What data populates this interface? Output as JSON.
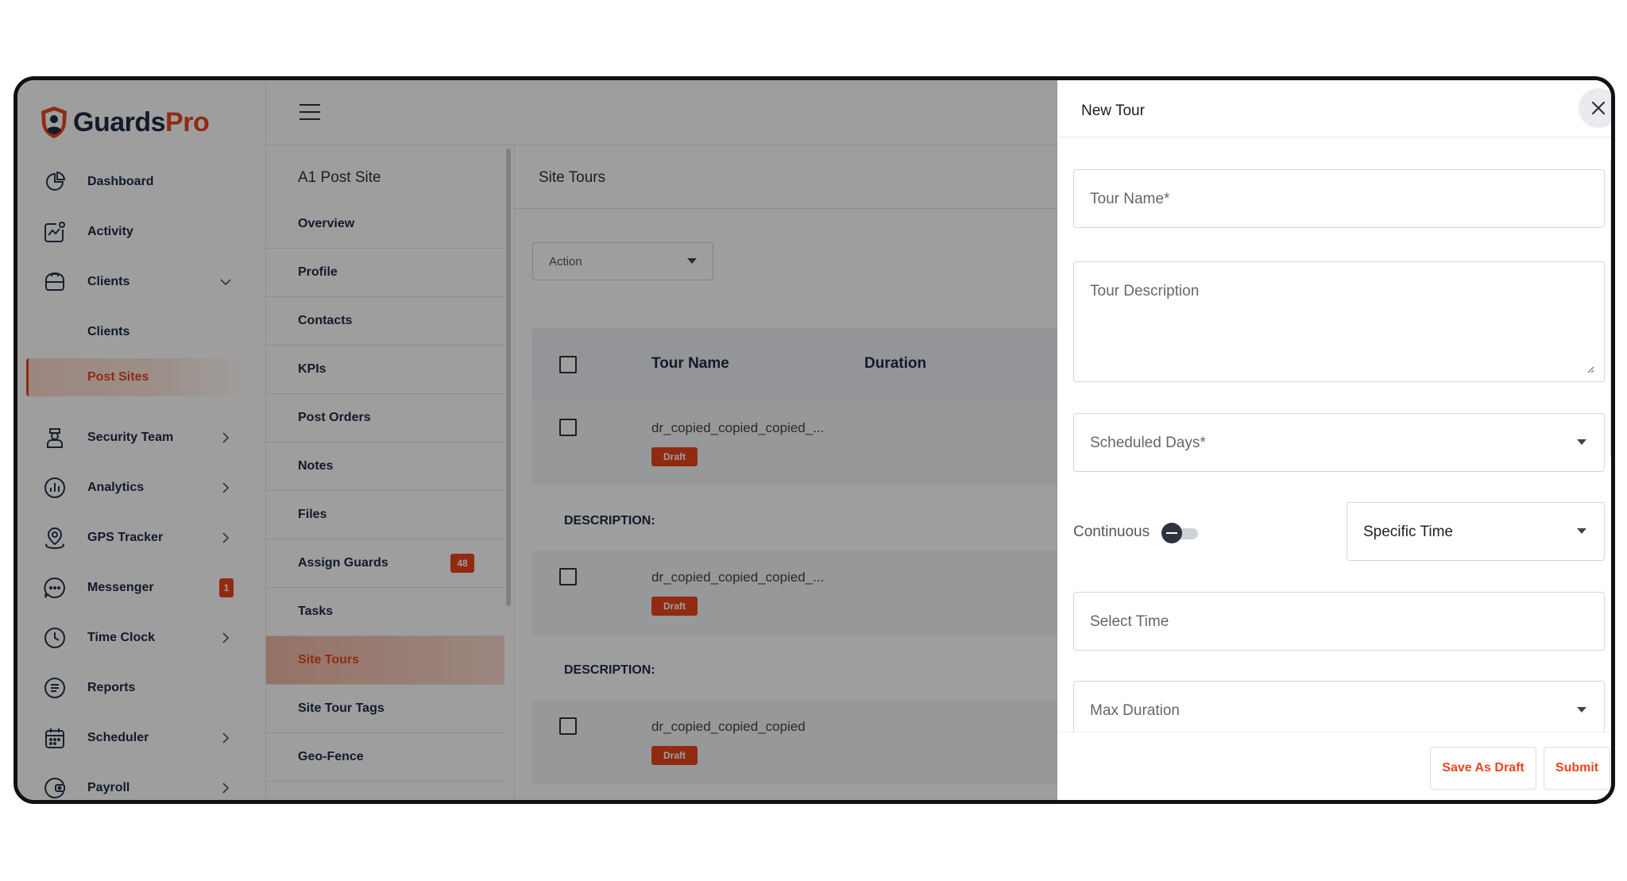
{
  "app": {
    "logo_part1": "Guards",
    "logo_part2": "Pro"
  },
  "sidebar": {
    "items": [
      {
        "label": "Dashboard",
        "icon": "dashboard-icon"
      },
      {
        "label": "Activity",
        "icon": "activity-icon"
      },
      {
        "label": "Clients",
        "icon": "clients-icon",
        "expanded": true
      },
      {
        "label": "Clients",
        "sub": true
      },
      {
        "label": "Post Sites",
        "sub": true,
        "active": true
      },
      {
        "label": "Security Team",
        "icon": "security-team-icon"
      },
      {
        "label": "Analytics",
        "icon": "analytics-icon"
      },
      {
        "label": "GPS Tracker",
        "icon": "gps-tracker-icon"
      },
      {
        "label": "Messenger",
        "icon": "messenger-icon",
        "badge": "1"
      },
      {
        "label": "Time Clock",
        "icon": "time-clock-icon"
      },
      {
        "label": "Reports",
        "icon": "reports-icon"
      },
      {
        "label": "Scheduler",
        "icon": "scheduler-icon"
      },
      {
        "label": "Payroll",
        "icon": "payroll-icon"
      }
    ]
  },
  "subnav": {
    "title": "A1 Post Site",
    "items": [
      {
        "label": "Overview"
      },
      {
        "label": "Profile"
      },
      {
        "label": "Contacts"
      },
      {
        "label": "KPIs"
      },
      {
        "label": "Post Orders"
      },
      {
        "label": "Notes"
      },
      {
        "label": "Files"
      },
      {
        "label": "Assign Guards",
        "badge": "48"
      },
      {
        "label": "Tasks"
      },
      {
        "label": "Site Tours",
        "active": true
      },
      {
        "label": "Site Tour Tags"
      },
      {
        "label": "Geo-Fence"
      }
    ]
  },
  "content": {
    "title": "Site Tours",
    "action_label": "Action",
    "table": {
      "headers": {
        "tour_name": "Tour Name",
        "duration": "Duration"
      },
      "rows": [
        {
          "name": "dr_copied_copied_copied_...",
          "status": "Draft",
          "description_label": "DESCRIPTION:"
        },
        {
          "name": "dr_copied_copied_copied_...",
          "status": "Draft",
          "description_label": "DESCRIPTION:"
        },
        {
          "name": "dr_copied_copied_copied",
          "status": "Draft"
        }
      ]
    }
  },
  "drawer": {
    "title": "New Tour",
    "fields": {
      "tour_name": "Tour Name*",
      "tour_description": "Tour Description",
      "scheduled_days": "Scheduled Days*",
      "continuous_label": "Continuous",
      "continuous_on": false,
      "time_mode": "Specific Time",
      "select_time": "Select Time",
      "max_duration": "Max Duration"
    },
    "buttons": {
      "save_draft": "Save As Draft",
      "submit": "Submit"
    }
  },
  "colors": {
    "accent": "#e8461e",
    "navy": "#1d2a44",
    "overlay": "rgba(0,0,0,0.38)"
  }
}
